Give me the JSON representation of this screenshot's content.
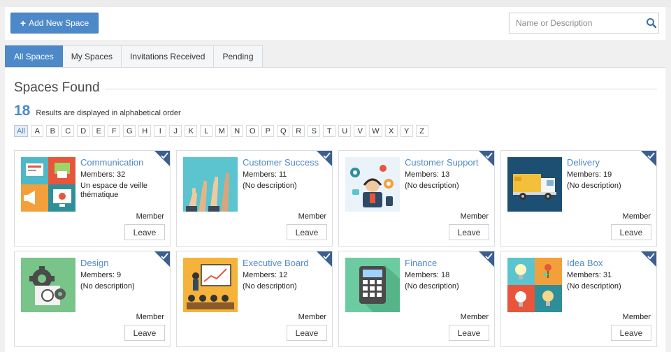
{
  "toolbar": {
    "add_label": "Add New Space"
  },
  "search": {
    "placeholder": "Name or Description"
  },
  "tabs": [
    {
      "label": "All Spaces",
      "active": true
    },
    {
      "label": "My Spaces",
      "active": false
    },
    {
      "label": "Invitations Received",
      "active": false
    },
    {
      "label": "Pending",
      "active": false
    }
  ],
  "section": {
    "title": "Spaces Found",
    "count": "18",
    "count_text": "Results are displayed in alphabetical order"
  },
  "alphabet": [
    "All",
    "A",
    "B",
    "C",
    "D",
    "E",
    "F",
    "G",
    "H",
    "I",
    "J",
    "K",
    "L",
    "M",
    "N",
    "O",
    "P",
    "Q",
    "R",
    "S",
    "T",
    "U",
    "V",
    "W",
    "X",
    "Y",
    "Z"
  ],
  "colors": {
    "accent": "#4d89c8",
    "corner": "#3b5f8f"
  },
  "spaces": [
    {
      "name": "Communication",
      "members": "Members: 32",
      "description": "Un espace de veille thématique",
      "role": "Member",
      "action": "Leave",
      "icon": "communication-thumbnail"
    },
    {
      "name": "Customer Success",
      "members": "Members: 11",
      "description": "(No description)",
      "role": "Member",
      "action": "Leave",
      "icon": "customer-success-thumbnail"
    },
    {
      "name": "Customer Support",
      "members": "Members: 13",
      "description": "(No description)",
      "role": "Member",
      "action": "Leave",
      "icon": "customer-support-thumbnail"
    },
    {
      "name": "Delivery",
      "members": "Members: 19",
      "description": "(No description)",
      "role": "Member",
      "action": "Leave",
      "icon": "delivery-truck-thumbnail"
    },
    {
      "name": "Design",
      "members": "Members: 9",
      "description": "(No description)",
      "role": "Member",
      "action": "Leave",
      "icon": "design-gears-thumbnail"
    },
    {
      "name": "Executive Board",
      "members": "Members: 12",
      "description": "(No description)",
      "role": "Member",
      "action": "Leave",
      "icon": "executive-board-thumbnail"
    },
    {
      "name": "Finance",
      "members": "Members: 18",
      "description": "(No description)",
      "role": "Member",
      "action": "Leave",
      "icon": "calculator-thumbnail"
    },
    {
      "name": "Idea Box",
      "members": "Members: 31",
      "description": "(No description)",
      "role": "Member",
      "action": "Leave",
      "icon": "idea-bulbs-thumbnail"
    }
  ]
}
